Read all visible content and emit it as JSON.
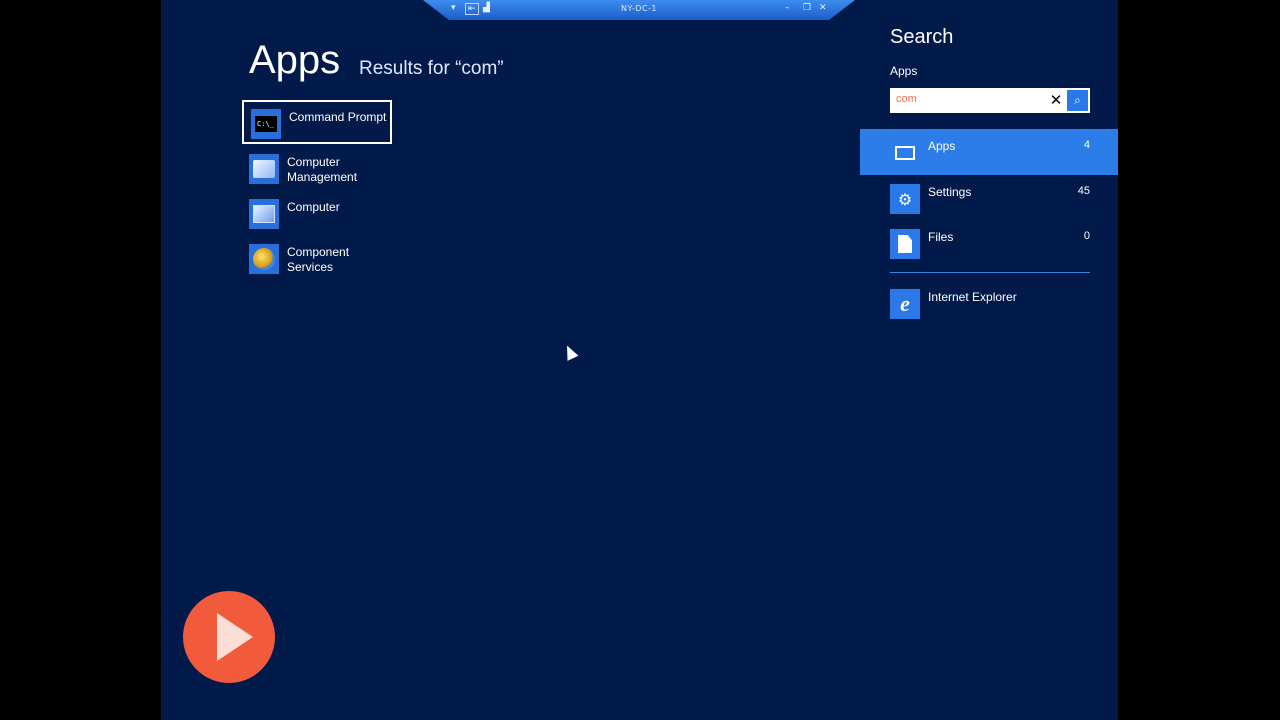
{
  "remote_bar": {
    "title": "NY-DC-1"
  },
  "left": {
    "heading": "Apps",
    "results_label": "Results for “com”",
    "results": [
      {
        "label": "Command Prompt",
        "icon": "command-prompt-icon",
        "selected": true
      },
      {
        "label": "Computer Management",
        "icon": "computer-management-icon"
      },
      {
        "label": "Computer",
        "icon": "computer-icon"
      },
      {
        "label": "Component Services",
        "icon": "component-services-icon"
      }
    ]
  },
  "search": {
    "title": "Search",
    "scope_label": "Apps",
    "query": "com",
    "scopes": [
      {
        "label": "Apps",
        "count": "4",
        "icon": "apps-keyboard-icon",
        "active": true
      },
      {
        "label": "Settings",
        "count": "45",
        "icon": "gear-icon"
      },
      {
        "label": "Files",
        "count": "0",
        "icon": "file-icon"
      }
    ],
    "extra_apps": [
      {
        "label": "Internet Explorer",
        "icon": "internet-explorer-icon"
      }
    ]
  },
  "colors": {
    "background": "#021a4a",
    "accent": "#2d7de8",
    "watermark": "#f15a3a"
  }
}
